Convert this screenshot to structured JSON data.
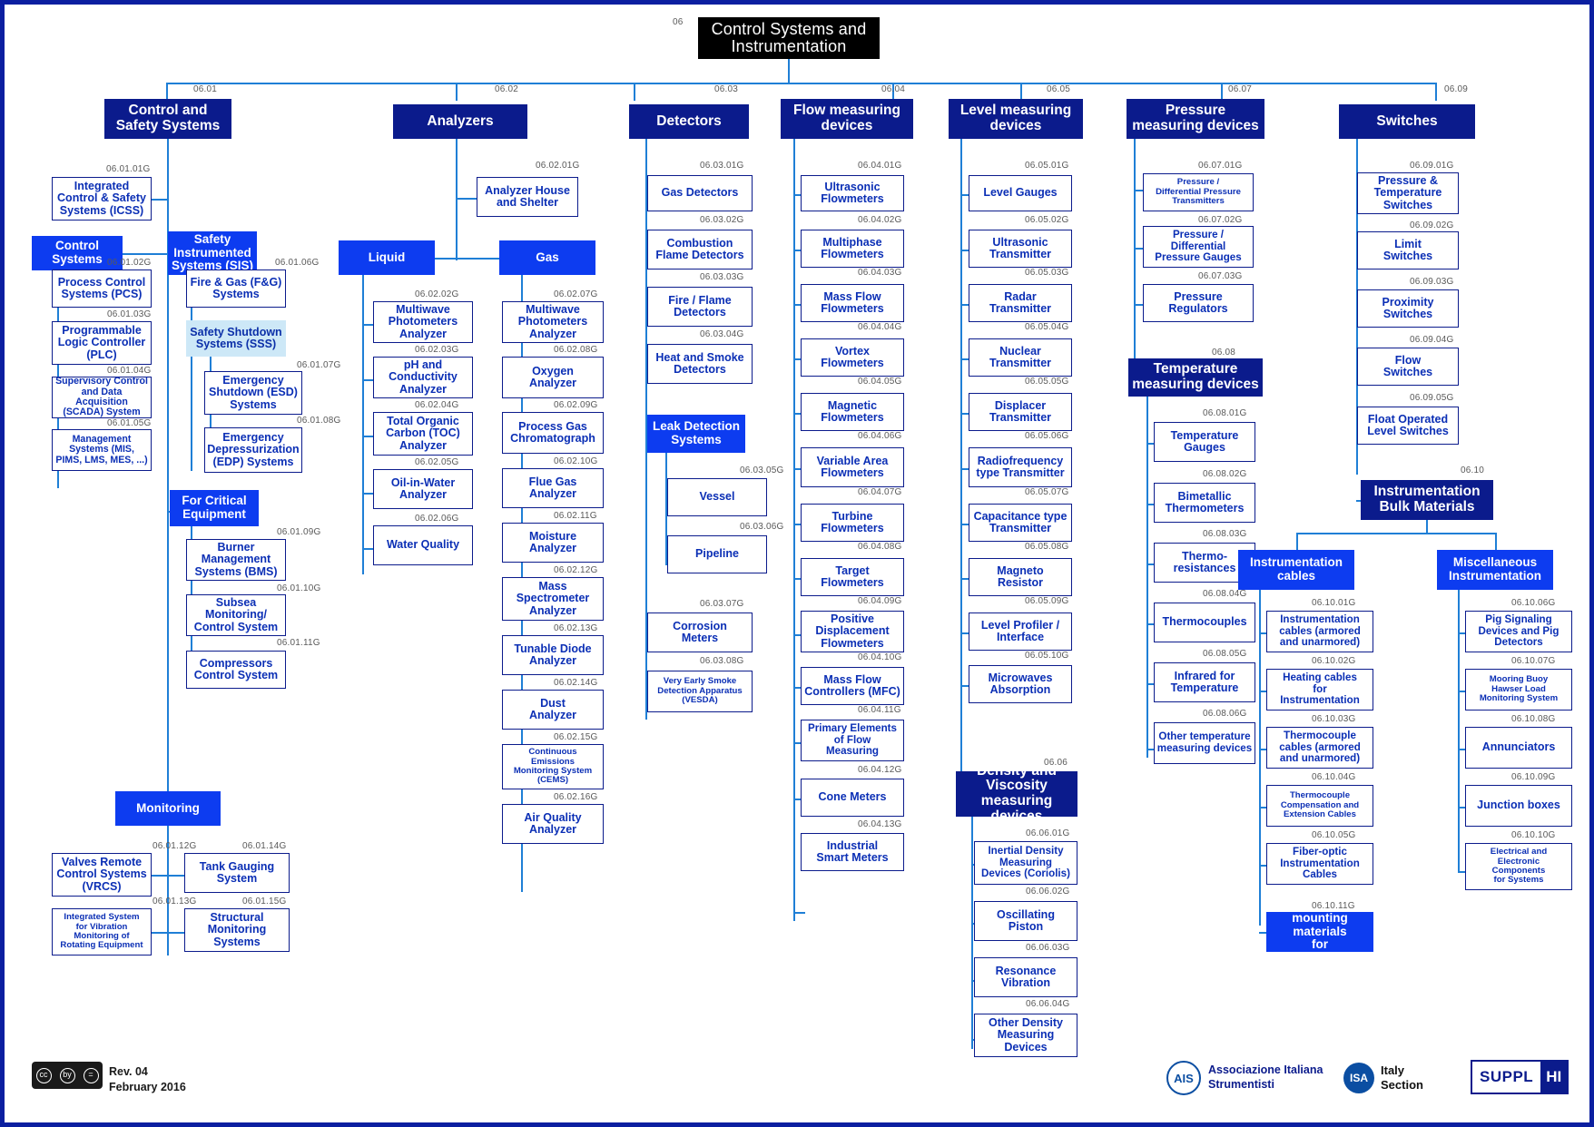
{
  "document": {
    "title": "Control Systems and Instrumentation",
    "root_code": "06",
    "revision": "Rev. 04",
    "date": "February 2016"
  },
  "footer": {
    "cc_license": "CC BY",
    "ais_mark": "AIS",
    "ais_name_line1": "Associazione Italiana",
    "ais_name_line2": "Strumentisti",
    "isa_mark": "ISA",
    "isa_line1": "Italy",
    "isa_line2": "Section",
    "suppl_left": "SUPPL",
    "suppl_right": "HI"
  },
  "colors": {
    "root": "#000000",
    "level1": "#0b1b8c",
    "group": "#0d3cf0",
    "group_light": "#cde8f7",
    "leaf_text": "#0b2fb5",
    "connector": "#1f7fd6",
    "code_text": "#595959",
    "frame": "#0b1fa0"
  },
  "branches": {
    "control_safety": {
      "code": "06.01",
      "label": "Control and\nSafety Systems",
      "icss": {
        "code": "06.01.01G",
        "label": "Integrated\nControl & Safety\nSystems (ICSS)"
      },
      "control_systems": {
        "label": "Control\nSystems",
        "children": [
          {
            "code": "06.01.02G",
            "label": "Process Control\nSystems (PCS)"
          },
          {
            "code": "06.01.03G",
            "label": "Programmable\nLogic Controller\n(PLC)"
          },
          {
            "code": "06.01.04G",
            "label": "Supervisory Control\nand Data Acquisition\n(SCADA) System"
          },
          {
            "code": "06.01.05G",
            "label": "Management\nSystems (MIS,\nPIMS, LMS, MES,  ...)"
          }
        ]
      },
      "sis": {
        "label": "Safety\nInstrumented\nSystems (SIS)",
        "fire_gas": {
          "code": "06.01.06G",
          "label": "Fire & Gas (F&G)\nSystems"
        },
        "sss": {
          "label": "Safety Shutdown\nSystems (SSS)",
          "children": [
            {
              "code": "06.01.07G",
              "label": "Emergency\nShutdown (ESD)\nSystems"
            },
            {
              "code": "06.01.08G",
              "label": "Emergency\nDepressurization\n(EDP) Systems"
            }
          ]
        }
      },
      "critical": {
        "label": "For Critical\nEquipment",
        "children": [
          {
            "code": "06.01.09G",
            "label": "Burner\nManagement\nSystems (BMS)"
          },
          {
            "code": "06.01.10G",
            "label": "Subsea\nMonitoring/\nControl System"
          },
          {
            "code": "06.01.11G",
            "label": "Compressors\nControl System"
          }
        ]
      },
      "monitoring": {
        "label": "Monitoring",
        "left": [
          {
            "code": "06.01.12G",
            "label": "Valves Remote\nControl Systems\n(VRCS)"
          },
          {
            "code": "06.01.13G",
            "label": "Integrated System\nfor Vibration\nMonitoring of\nRotating Equipment"
          }
        ],
        "right": [
          {
            "code": "06.01.14G",
            "label": "Tank Gauging\nSystem"
          },
          {
            "code": "06.01.15G",
            "label": "Structural\nMonitoring\nSystems"
          }
        ]
      }
    },
    "analyzers": {
      "code": "06.02",
      "label": "Analyzers",
      "house": {
        "code": "06.02.01G",
        "label": "Analyzer House\nand Shelter"
      },
      "liquid": {
        "label": "Liquid",
        "children": [
          {
            "code": "06.02.02G",
            "label": "Multiwave\nPhotometers\nAnalyzer"
          },
          {
            "code": "06.02.03G",
            "label": "pH and\nConductivity\nAnalyzer"
          },
          {
            "code": "06.02.04G",
            "label": "Total Organic\nCarbon (TOC)\nAnalyzer"
          },
          {
            "code": "06.02.05G",
            "label": "Oil-in-Water\nAnalyzer"
          },
          {
            "code": "06.02.06G",
            "label": "Water Quality"
          }
        ]
      },
      "gas": {
        "label": "Gas",
        "children": [
          {
            "code": "06.02.07G",
            "label": "Multiwave\nPhotometers\nAnalyzer"
          },
          {
            "code": "06.02.08G",
            "label": "Oxygen\nAnalyzer"
          },
          {
            "code": "06.02.09G",
            "label": "Process Gas\nChromatograph"
          },
          {
            "code": "06.02.10G",
            "label": "Flue Gas\nAnalyzer"
          },
          {
            "code": "06.02.11G",
            "label": "Moisture\nAnalyzer"
          },
          {
            "code": "06.02.12G",
            "label": "Mass\nSpectrometer\nAnalyzer"
          },
          {
            "code": "06.02.13G",
            "label": "Tunable Diode\nAnalyzer"
          },
          {
            "code": "06.02.14G",
            "label": "Dust\nAnalyzer"
          },
          {
            "code": "06.02.15G",
            "label": "Continuous\nEmissions\nMonitoring System\n(CEMS)"
          },
          {
            "code": "06.02.16G",
            "label": "Air Quality\nAnalyzer"
          }
        ]
      }
    },
    "detectors": {
      "code": "06.03",
      "label": "Detectors",
      "children": [
        {
          "code": "06.03.01G",
          "label": "Gas Detectors"
        },
        {
          "code": "06.03.02G",
          "label": "Combustion\nFlame Detectors"
        },
        {
          "code": "06.03.03G",
          "label": "Fire / Flame\nDetectors"
        },
        {
          "code": "06.03.04G",
          "label": "Heat and Smoke\nDetectors"
        }
      ],
      "leak_detection": {
        "label": "Leak Detection\nSystems",
        "children": [
          {
            "code": "06.03.05G",
            "label": "Vessel"
          },
          {
            "code": "06.03.06G",
            "label": "Pipeline"
          }
        ]
      },
      "tail": [
        {
          "code": "06.03.07G",
          "label": "Corrosion\nMeters"
        },
        {
          "code": "06.03.08G",
          "label": "Very Early Smoke\nDetection Apparatus\n(VESDA)"
        }
      ]
    },
    "flow": {
      "code": "06.04",
      "label": "Flow measuring\ndevices",
      "children": [
        {
          "code": "06.04.01G",
          "label": "Ultrasonic\nFlowmeters"
        },
        {
          "code": "06.04.02G",
          "label": "Multiphase\nFlowmeters"
        },
        {
          "code": "06.04.03G",
          "label": "Mass Flow\nFlowmeters"
        },
        {
          "code": "06.04.04G",
          "label": "Vortex\nFlowmeters"
        },
        {
          "code": "06.04.05G",
          "label": "Magnetic\nFlowmeters"
        },
        {
          "code": "06.04.06G",
          "label": "Variable Area\nFlowmeters"
        },
        {
          "code": "06.04.07G",
          "label": "Turbine\nFlowmeters"
        },
        {
          "code": "06.04.08G",
          "label": "Target\nFlowmeters"
        },
        {
          "code": "06.04.09G",
          "label": "Positive\nDisplacement\nFlowmeters"
        },
        {
          "code": "06.04.10G",
          "label": "Mass Flow\nControllers (MFC)"
        },
        {
          "code": "06.04.11G",
          "label": "Primary Elements\nof Flow\nMeasuring"
        },
        {
          "code": "06.04.12G",
          "label": "Cone Meters"
        },
        {
          "code": "06.04.13G",
          "label": "Industrial\nSmart Meters"
        }
      ]
    },
    "level": {
      "code": "06.05",
      "label": "Level measuring\ndevices",
      "children": [
        {
          "code": "06.05.01G",
          "label": "Level Gauges"
        },
        {
          "code": "06.05.02G",
          "label": "Ultrasonic\nTransmitter"
        },
        {
          "code": "06.05.03G",
          "label": "Radar\nTransmitter"
        },
        {
          "code": "06.05.04G",
          "label": "Nuclear\nTransmitter"
        },
        {
          "code": "06.05.05G",
          "label": "Displacer\nTransmitter"
        },
        {
          "code": "06.05.06G",
          "label": "Radiofrequency\ntype Transmitter"
        },
        {
          "code": "06.05.07G",
          "label": "Capacitance type\nTransmitter"
        },
        {
          "code": "06.05.08G",
          "label": "Magneto\nResistor"
        },
        {
          "code": "06.05.09G",
          "label": "Level Profiler /\nInterface"
        },
        {
          "code": "06.05.10G",
          "label": "Microwaves\nAbsorption"
        }
      ]
    },
    "density": {
      "code": "06.06",
      "label": "Density and\nViscosity\nmeasuring devices",
      "children": [
        {
          "code": "06.06.01G",
          "label": "Inertial Density\nMeasuring\nDevices (Coriolis)"
        },
        {
          "code": "06.06.02G",
          "label": "Oscillating\nPiston"
        },
        {
          "code": "06.06.03G",
          "label": "Resonance\nVibration"
        },
        {
          "code": "06.06.04G",
          "label": "Other Density\nMeasuring\nDevices"
        }
      ]
    },
    "pressure": {
      "code": "06.07",
      "label": "Pressure\nmeasuring devices",
      "children": [
        {
          "code": "06.07.01G",
          "label": "Pressure /\nDifferential Pressure\nTransmitters"
        },
        {
          "code": "06.07.02G",
          "label": "Pressure /\nDifferential\nPressure Gauges"
        },
        {
          "code": "06.07.03G",
          "label": "Pressure\nRegulators"
        }
      ]
    },
    "temperature": {
      "code": "06.08",
      "label": "Temperature\nmeasuring devices",
      "children": [
        {
          "code": "06.08.01G",
          "label": "Temperature\nGauges"
        },
        {
          "code": "06.08.02G",
          "label": "Bimetallic\nThermometers"
        },
        {
          "code": "06.08.03G",
          "label": "Thermo-\nresistances"
        },
        {
          "code": "06.08.04G",
          "label": "Thermocouples"
        },
        {
          "code": "06.08.05G",
          "label": "Infrared for\nTemperature"
        },
        {
          "code": "06.08.06G",
          "label": "Other temperature\nmeasuring devices"
        }
      ]
    },
    "switches": {
      "code": "06.09",
      "label": "Switches",
      "children": [
        {
          "code": "06.09.01G",
          "label": "Pressure &\nTemperature\nSwitches"
        },
        {
          "code": "06.09.02G",
          "label": "Limit\nSwitches"
        },
        {
          "code": "06.09.03G",
          "label": "Proximity\nSwitches"
        },
        {
          "code": "06.09.04G",
          "label": "Flow\nSwitches"
        },
        {
          "code": "06.09.05G",
          "label": "Float Operated\nLevel Switches"
        }
      ]
    },
    "bulk": {
      "code": "06.10",
      "label": "Instrumentation\nBulk Materials",
      "cables": {
        "label": "Instrumentation\ncables",
        "children": [
          {
            "code": "06.10.01G",
            "label": "Instrumentation\ncables (armored\nand unarmored)"
          },
          {
            "code": "06.10.02G",
            "label": "Heating cables\nfor\nInstrumentation"
          },
          {
            "code": "06.10.03G",
            "label": "Thermocouple\ncables (armored\nand unarmored)"
          },
          {
            "code": "06.10.04G",
            "label": "Thermocouple\nCompensation and\nExtension Cables"
          },
          {
            "code": "06.10.05G",
            "label": "Fiber-optic\nInstrumentation\nCables"
          }
        ],
        "tubing": {
          "code": "06.10.11G",
          "label": "Tubing and\nmounting materials\nfor Instrumentation"
        }
      },
      "misc": {
        "label": "Miscellaneous\nInstrumentation",
        "children": [
          {
            "code": "06.10.06G",
            "label": "Pig Signaling\nDevices and Pig\nDetectors"
          },
          {
            "code": "06.10.07G",
            "label": "Mooring Buoy\nHawser Load\nMonitoring System"
          },
          {
            "code": "06.10.08G",
            "label": "Annunciators"
          },
          {
            "code": "06.10.09G",
            "label": "Junction boxes"
          },
          {
            "code": "06.10.10G",
            "label": "Electrical and\nElectronic\nComponents\nfor Systems"
          }
        ]
      }
    }
  }
}
